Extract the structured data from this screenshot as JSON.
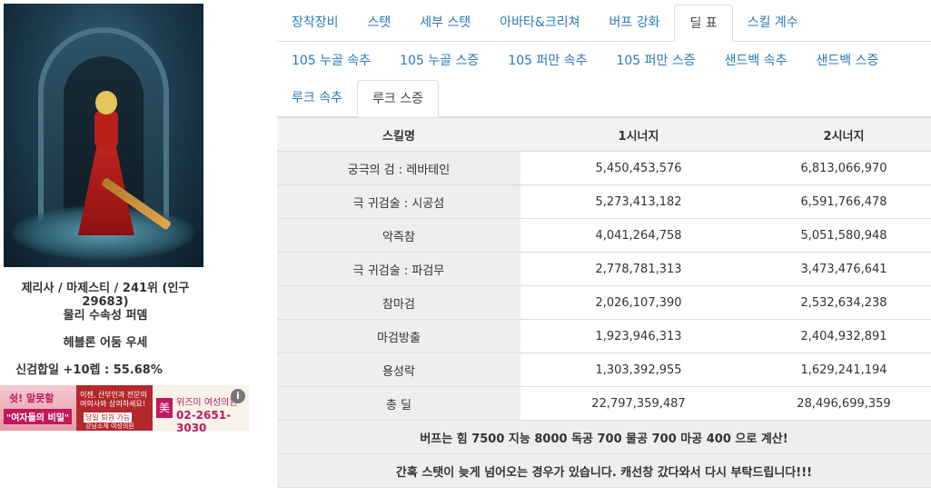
{
  "character": {
    "summary": "제리사 / 마제스티 / 241위 (인구 29683)",
    "element": "물리 수속성 퍼뎀",
    "dungeon": "헤블론 어둠 우세",
    "sync_rate": "신검합일 +10렙 : 55.68%"
  },
  "ad": {
    "left_title": "쉿! 말못할",
    "left_sub": "\"여자들의 비밀\"",
    "mid_text": "이젠, 산부인과 전문의 여의사와 상의하세요!",
    "mid_sub": "당일 퇴원 가능",
    "mid_clinic": "강남소재 여성의원",
    "right_logo": "美",
    "right_title": "위즈미 여성의원",
    "right_phone": "02-2651-3030",
    "info_icon": "i"
  },
  "tabs_row1": [
    "장착장비",
    "스탯",
    "세부 스탯",
    "아바타&크리쳐",
    "버프 강화",
    "딜 표",
    "스킬 계수"
  ],
  "tabs_row2": [
    "105 누골 속추",
    "105 누골 스증",
    "105 퍼만 속추",
    "105 퍼만 스증",
    "샌드백 속추",
    "샌드백 스증"
  ],
  "tabs_row3": [
    "루크 속추",
    "루크 스증"
  ],
  "active_main_tab": "딜 표",
  "active_sub_tab": "루크 스증",
  "table": {
    "headers": [
      "스킬명",
      "1시너지",
      "2시너지"
    ],
    "rows": [
      {
        "name": "궁극의 검 : 레바테인",
        "s1": "5,450,453,576",
        "s2": "6,813,066,970"
      },
      {
        "name": "극 귀검술 : 시공섬",
        "s1": "5,273,413,182",
        "s2": "6,591,766,478"
      },
      {
        "name": "악즉참",
        "s1": "4,041,264,758",
        "s2": "5,051,580,948"
      },
      {
        "name": "극 귀검술 : 파검무",
        "s1": "2,778,781,313",
        "s2": "3,473,476,641"
      },
      {
        "name": "참마검",
        "s1": "2,026,107,390",
        "s2": "2,532,634,238"
      },
      {
        "name": "마검방출",
        "s1": "1,923,946,313",
        "s2": "2,404,932,891"
      },
      {
        "name": "용성락",
        "s1": "1,303,392,955",
        "s2": "1,629,241,194"
      },
      {
        "name": "총 딜",
        "s1": "22,797,359,487",
        "s2": "28,496,699,359"
      }
    ],
    "buff_note": "버프는 힘 7500 지능 8000 독공 700 물공 700 마공 400 으로 계산!",
    "stat_note": "간혹 스탯이 늦게 넘어오는 경우가 있습니다. 캐선창 갔다와서 다시 부탁드립니다!!!"
  }
}
